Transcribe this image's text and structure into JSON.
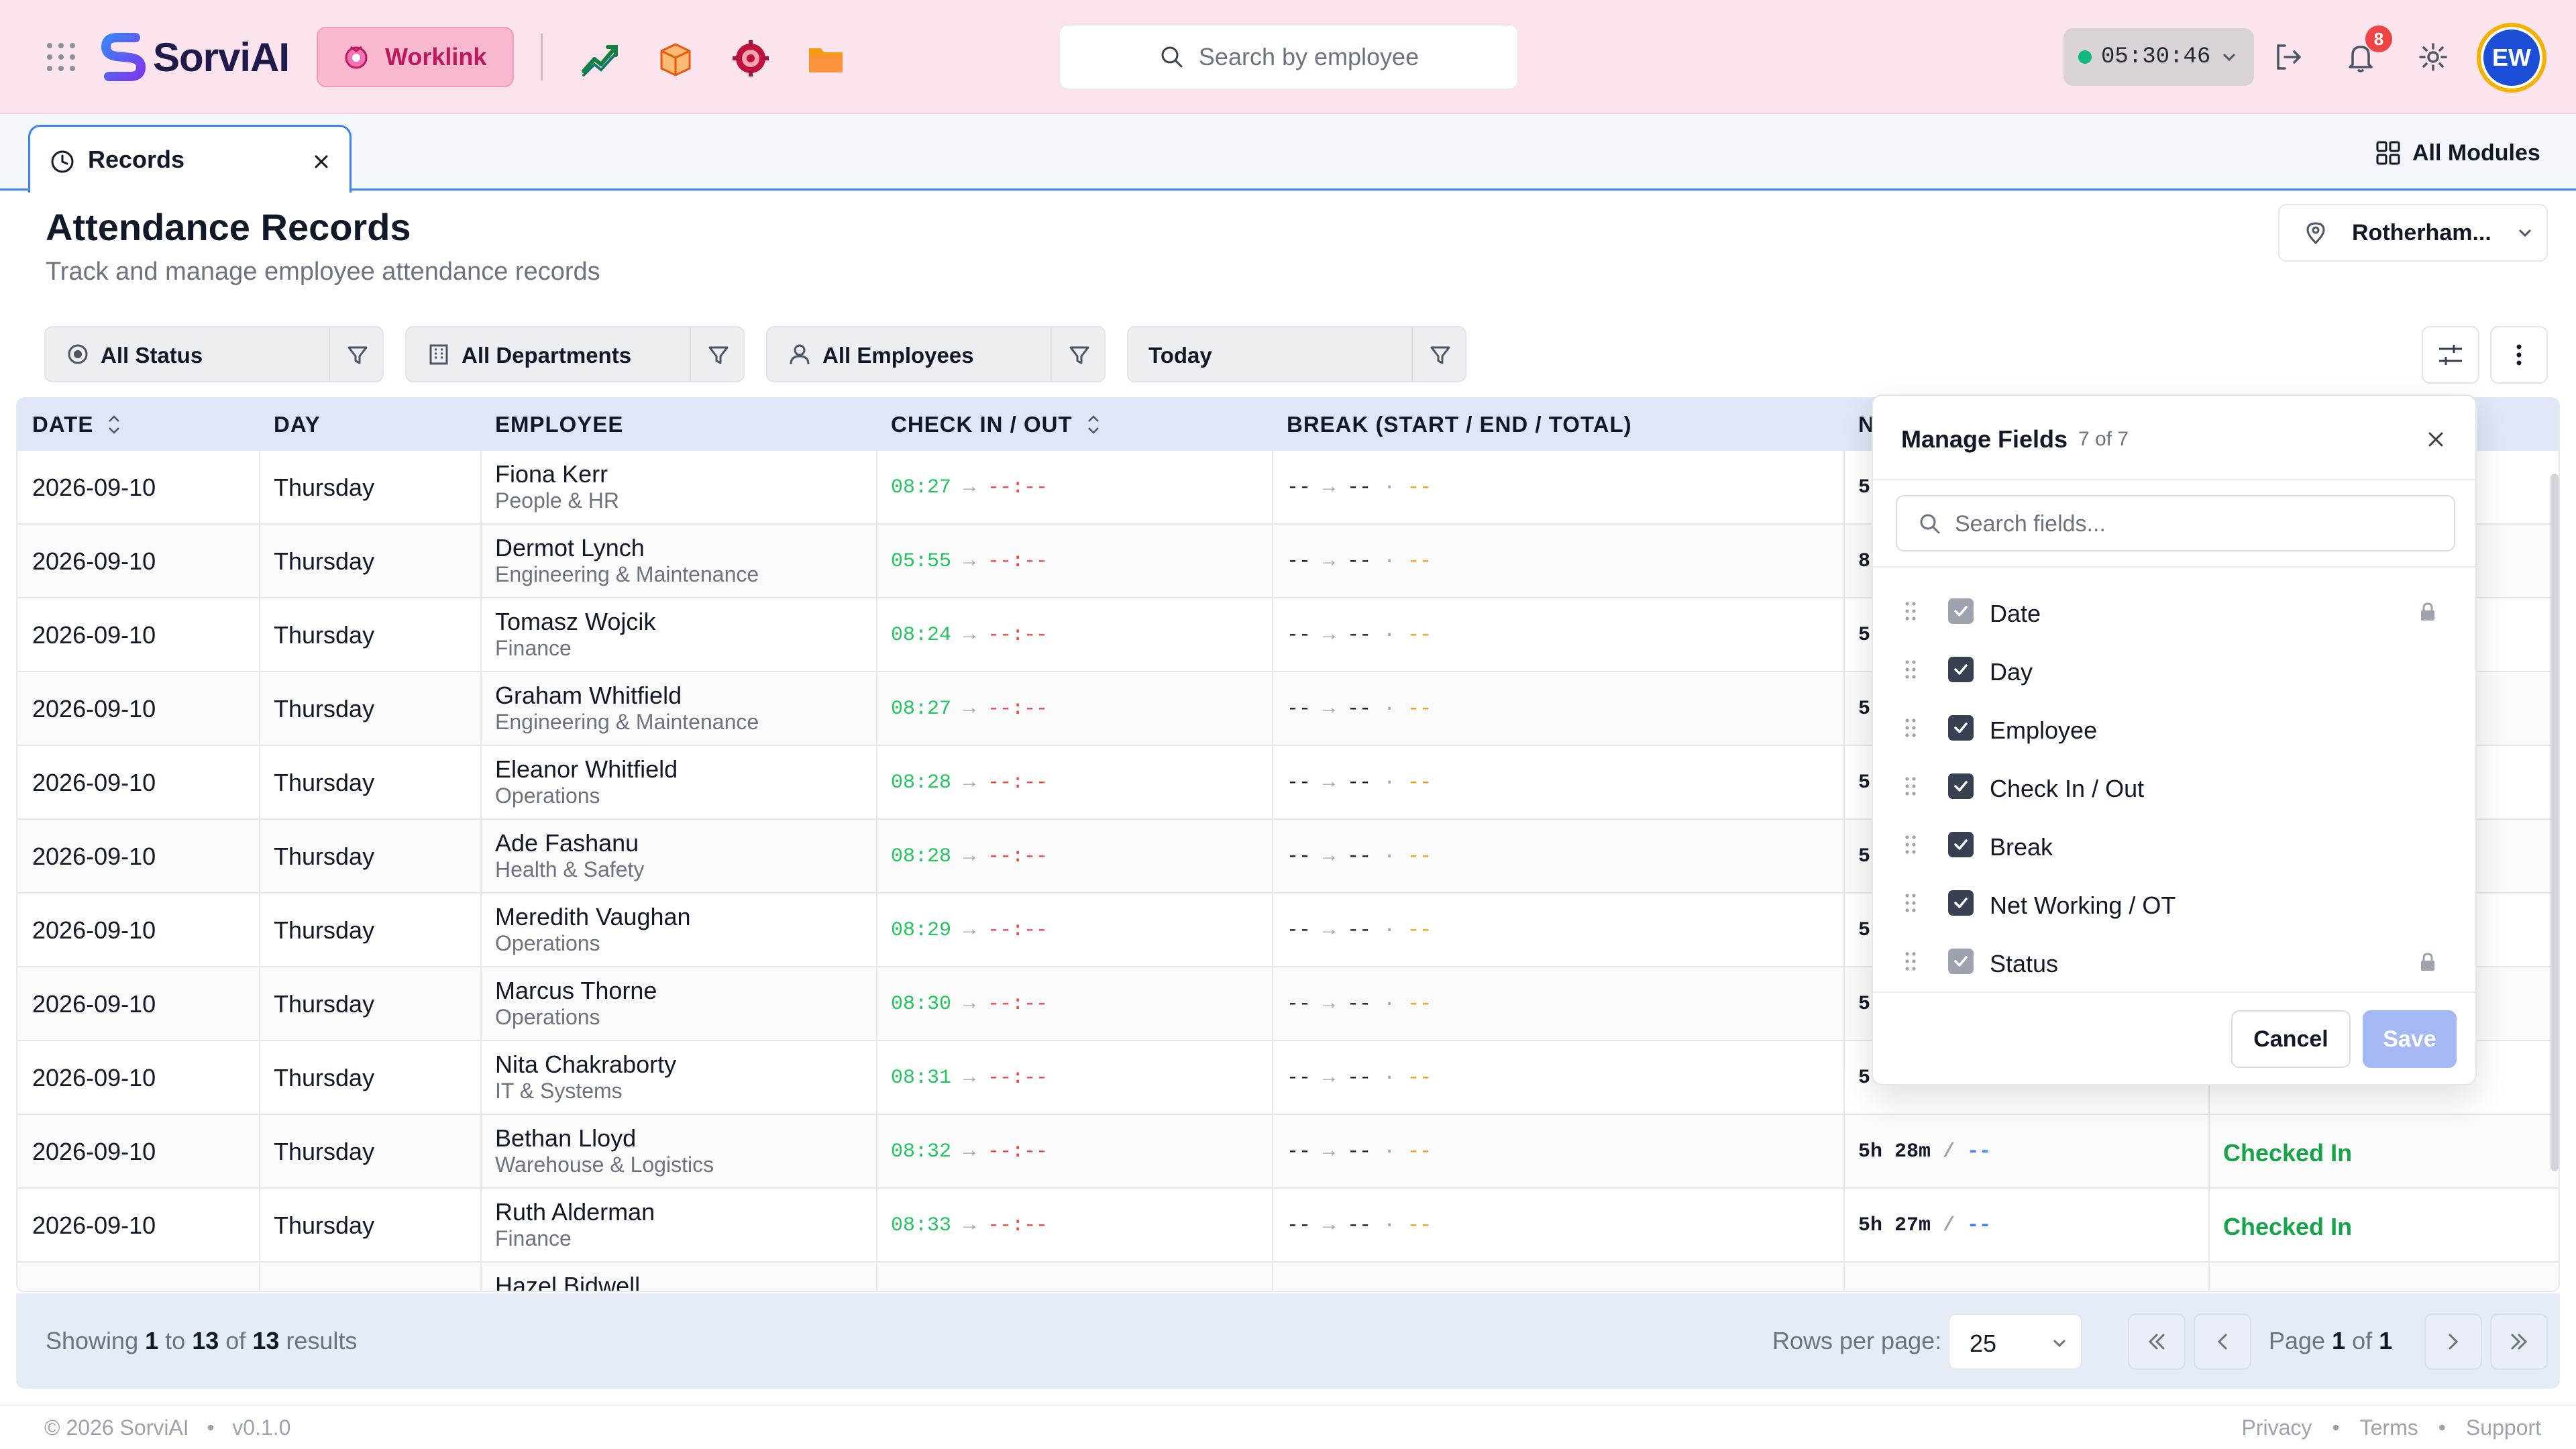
{
  "header": {
    "brand": "SorviAI",
    "active_module": "Worklink",
    "search_placeholder": "Search by employee",
    "timer": "05:30:46",
    "notification_count": "8",
    "user_initials": "EW",
    "module_icons": [
      "trend-chart-icon",
      "package-icon",
      "gear-target-icon",
      "folder-icon"
    ]
  },
  "tabs": {
    "active_label": "Records",
    "all_modules_label": "All Modules"
  },
  "page": {
    "title": "Attendance Records",
    "subtitle": "Track and manage employee attendance records",
    "location": "Rotherham..."
  },
  "filters": [
    {
      "label": "All Status",
      "icon": "radio-icon"
    },
    {
      "label": "All Departments",
      "icon": "building-icon"
    },
    {
      "label": "All Employees",
      "icon": "user-icon"
    },
    {
      "label": "Today",
      "icon": ""
    }
  ],
  "table": {
    "columns": [
      "DATE",
      "DAY",
      "EMPLOYEE",
      "CHECK IN / OUT",
      "BREAK (START / END / TOTAL)",
      "N"
    ],
    "arrow": "→",
    "dot": "·",
    "rows": [
      {
        "date": "2026-09-10",
        "day": "Thursday",
        "name": "Fiona Kerr",
        "dept": "People & HR",
        "in": "08:27",
        "in_color": "#22c55e",
        "out": "--:--",
        "net": "5",
        "status": ""
      },
      {
        "date": "2026-09-10",
        "day": "Thursday",
        "name": "Dermot Lynch",
        "dept": "Engineering & Maintenance",
        "in": "05:55",
        "in_color": "#22c55e",
        "out": "--:--",
        "net": "8",
        "status": ""
      },
      {
        "date": "2026-09-10",
        "day": "Thursday",
        "name": "Tomasz Wojcik",
        "dept": "Finance",
        "in": "08:24",
        "in_color": "#22c55e",
        "out": "--:--",
        "net": "5",
        "status": ""
      },
      {
        "date": "2026-09-10",
        "day": "Thursday",
        "name": "Graham Whitfield",
        "dept": "Engineering & Maintenance",
        "in": "08:27",
        "in_color": "#22c55e",
        "out": "--:--",
        "net": "5",
        "status": ""
      },
      {
        "date": "2026-09-10",
        "day": "Thursday",
        "name": "Eleanor Whitfield",
        "dept": "Operations",
        "in": "08:28",
        "in_color": "#22c55e",
        "out": "--:--",
        "net": "5",
        "status": ""
      },
      {
        "date": "2026-09-10",
        "day": "Thursday",
        "name": "Ade Fashanu",
        "dept": "Health & Safety",
        "in": "08:28",
        "in_color": "#22c55e",
        "out": "--:--",
        "net": "5",
        "status": ""
      },
      {
        "date": "2026-09-10",
        "day": "Thursday",
        "name": "Meredith Vaughan",
        "dept": "Operations",
        "in": "08:29",
        "in_color": "#22c55e",
        "out": "--:--",
        "net": "5",
        "status": ""
      },
      {
        "date": "2026-09-10",
        "day": "Thursday",
        "name": "Marcus Thorne",
        "dept": "Operations",
        "in": "08:30",
        "in_color": "#22c55e",
        "out": "--:--",
        "net": "5",
        "status": ""
      },
      {
        "date": "2026-09-10",
        "day": "Thursday",
        "name": "Nita Chakraborty",
        "dept": "IT & Systems",
        "in": "08:31",
        "in_color": "#22c55e",
        "out": "--:--",
        "net": "5.",
        "status": ""
      },
      {
        "date": "2026-09-10",
        "day": "Thursday",
        "name": "Bethan Lloyd",
        "dept": "Warehouse & Logistics",
        "in": "08:32",
        "in_color": "#22c55e",
        "out": "--:--",
        "net": "5h 28m",
        "status": "Checked In"
      },
      {
        "date": "2026-09-10",
        "day": "Thursday",
        "name": "Ruth Alderman",
        "dept": "Finance",
        "in": "08:33",
        "in_color": "#22c55e",
        "out": "--:--",
        "net": "5h 27m",
        "status": "Checked In"
      },
      {
        "date": "",
        "day": "",
        "name": "Hazel Bidwell",
        "dept": "",
        "in": "",
        "in_color": "#22c55e",
        "out": "",
        "net": "",
        "status": ""
      }
    ],
    "break_placeholder": "--",
    "ot_placeholder": "--"
  },
  "pagination": {
    "showing_prefix": "Showing",
    "from": "1",
    "to_word": "to",
    "to": "13",
    "of_word": "of",
    "total": "13",
    "results_word": "results",
    "rows_per_page_label": "Rows per page:",
    "rows_per_page": "25",
    "page_word": "Page",
    "page": "1",
    "page_of_word": "of",
    "pages": "1"
  },
  "footer": {
    "copyright": "© 2026 SorviAI",
    "version": "v0.1.0",
    "links": [
      "Privacy",
      "Terms",
      "Support"
    ]
  },
  "manage_fields": {
    "title": "Manage Fields",
    "count": "7 of 7",
    "search_placeholder": "Search fields...",
    "fields": [
      {
        "label": "Date",
        "checked": true,
        "locked": true
      },
      {
        "label": "Day",
        "checked": true,
        "locked": false
      },
      {
        "label": "Employee",
        "checked": true,
        "locked": false
      },
      {
        "label": "Check In / Out",
        "checked": true,
        "locked": false
      },
      {
        "label": "Break",
        "checked": true,
        "locked": false
      },
      {
        "label": "Net Working / OT",
        "checked": true,
        "locked": false
      },
      {
        "label": "Status",
        "checked": true,
        "locked": true
      }
    ],
    "cancel_label": "Cancel",
    "save_label": "Save"
  },
  "colors": {
    "topbar_bg": "#fce4ef",
    "accent_pink": "#be185d",
    "accent_blue": "#3b82f6",
    "status_green": "#16a34a",
    "checkin_green": "#22c55e",
    "checkout_red": "#ef4444",
    "break_orange": "#f59e0b"
  }
}
